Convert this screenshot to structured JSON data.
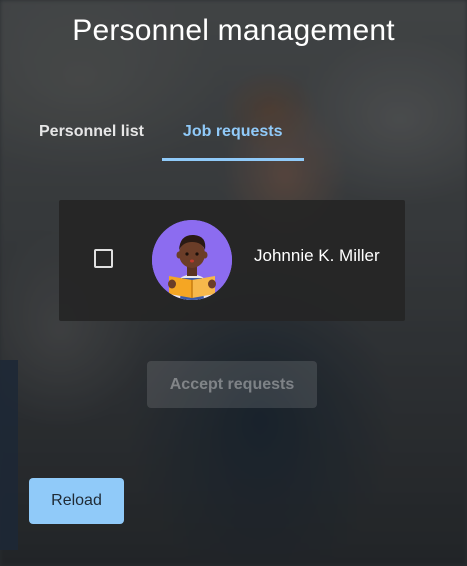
{
  "header": {
    "title": "Personnel management"
  },
  "tabs": [
    {
      "label": "Personnel list",
      "active": false
    },
    {
      "label": "Job requests",
      "active": true
    }
  ],
  "requests": [
    {
      "name": "Johnnie K. Miller",
      "checked": false,
      "avatar_icon": "reading-person-avatar-icon"
    }
  ],
  "actions": {
    "accept_label": "Accept requests",
    "accept_disabled": true,
    "reload_label": "Reload"
  },
  "colors": {
    "accent": "#90caf9",
    "card_bg": "#252525",
    "avatar_bg": "#8c6cf0"
  }
}
